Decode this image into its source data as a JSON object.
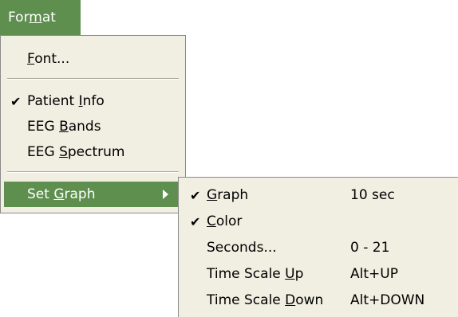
{
  "menubar": {
    "format": {
      "pre": "For",
      "mn": "m",
      "post": "at"
    }
  },
  "menu": {
    "font": {
      "mn": "F",
      "post": "ont..."
    },
    "patient_info": {
      "pre": "Patient ",
      "mn": "I",
      "post": "nfo",
      "checked": true
    },
    "eeg_bands": {
      "pre": "EEG ",
      "mn": "B",
      "post": "ands"
    },
    "eeg_spectrum": {
      "pre": "EEG ",
      "mn": "S",
      "post": "pectrum"
    },
    "set_graph": {
      "pre": "Set ",
      "mn": "G",
      "post": "raph"
    }
  },
  "submenu": {
    "graph": {
      "mn": "G",
      "post": "raph",
      "value": "10 sec",
      "checked": true
    },
    "color": {
      "mn": "C",
      "post": "olor",
      "checked": true
    },
    "seconds": {
      "label": "Seconds...",
      "value": "0 - 21"
    },
    "ts_up": {
      "pre": "Time Scale ",
      "mn": "U",
      "post": "p",
      "value": "Alt+UP"
    },
    "ts_down": {
      "pre": "Time Scale ",
      "mn": "D",
      "post": "own",
      "value": "Alt+DOWN"
    }
  },
  "icons": {
    "check": "✔"
  },
  "colors": {
    "accent": "#5e8f4f",
    "menu_bg": "#f1efe2"
  }
}
